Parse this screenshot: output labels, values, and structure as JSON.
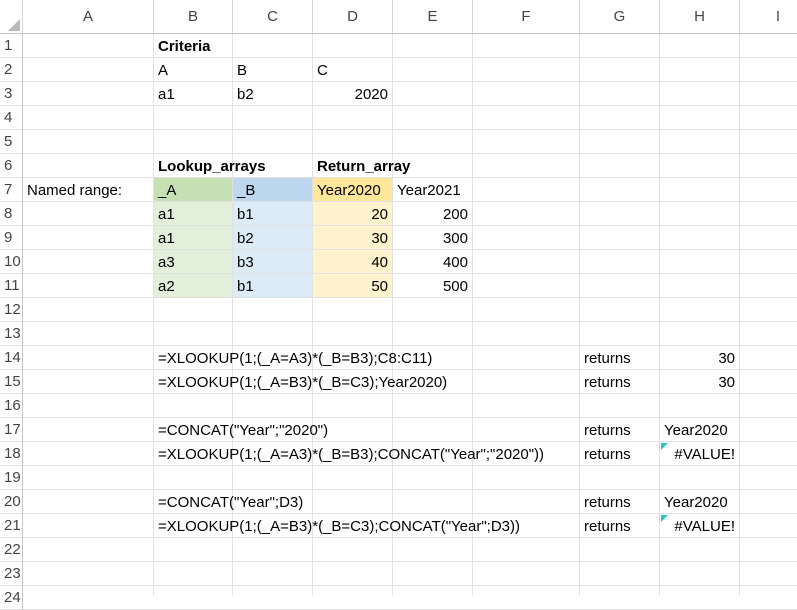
{
  "columns": [
    "A",
    "B",
    "C",
    "D",
    "E",
    "F",
    "G",
    "H",
    "I"
  ],
  "rows": [
    "1",
    "2",
    "3",
    "4",
    "5",
    "6",
    "7",
    "8",
    "9",
    "10",
    "11",
    "12",
    "13",
    "14",
    "15",
    "16",
    "17",
    "18",
    "19",
    "20",
    "21",
    "22",
    "23",
    "24"
  ],
  "colors": {
    "lookup_fill": "#e2efda",
    "lookup_header_fill": "#c6e0b4",
    "b_fill": "#ddebf7",
    "b_header_fill": "#bdd7ee",
    "return_fill": "#fff2cc",
    "return_header_fill": "#ffe699",
    "error_indicator": "#22c7c7"
  },
  "cells": {
    "B1": "Criteria",
    "B2": "A",
    "C2": "B",
    "D2": "C",
    "B3": "a1",
    "C3": "b2",
    "D3": "2020",
    "B6": "Lookup_arrays",
    "D6": "Return_array",
    "A7": "Named range:",
    "B7": "_A",
    "C7": "_B",
    "D7": "Year2020",
    "E7": "Year2021",
    "B8": "a1",
    "C8": "b1",
    "D8": "20",
    "E8": "200",
    "B9": "a1",
    "C9": "b2",
    "D9": "30",
    "E9": "300",
    "B10": "a3",
    "C10": "b3",
    "D10": "40",
    "E10": "400",
    "B11": "a2",
    "C11": "b1",
    "D11": "50",
    "E11": "500",
    "B14": "=XLOOKUP(1;(_A=A3)*(_B=B3);C8:C11)",
    "G14": "returns",
    "H14": "30",
    "B15": "=XLOOKUP(1;(_A=B3)*(_B=C3);Year2020)",
    "G15": "returns",
    "H15": "30",
    "B17": "=CONCAT(\"Year\";\"2020\")",
    "G17": "returns",
    "H17": "Year2020",
    "B18": "=XLOOKUP(1;(_A=A3)*(_B=B3);CONCAT(\"Year\";\"2020\"))",
    "G18": "returns",
    "H18": "#VALUE!",
    "B20": "=CONCAT(\"Year\";D3)",
    "G20": "returns",
    "H20": "Year2020",
    "B21": "=XLOOKUP(1;(_A=B3)*(_B=C3);CONCAT(\"Year\";D3))",
    "G21": "returns",
    "H21": "#VALUE!"
  }
}
